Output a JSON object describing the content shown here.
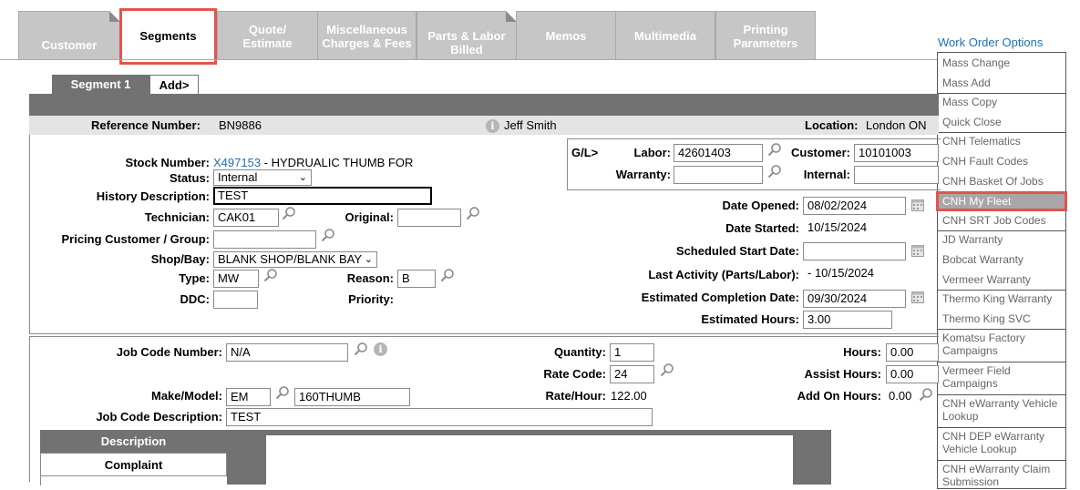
{
  "tabs": [
    {
      "label": "Customer"
    },
    {
      "label": "Segments"
    },
    {
      "label": "Quote/ Estimate"
    },
    {
      "label": "Miscellaneous Charges & Fees"
    },
    {
      "label": "Parts & Labor Billed"
    },
    {
      "label": "Memos"
    },
    {
      "label": "Multimedia"
    },
    {
      "label": "Printing Parameters"
    }
  ],
  "work_order_options": {
    "label": "Work Order Options",
    "items": [
      "Mass Change",
      "Mass Add",
      "Mass Copy",
      "Quick Close",
      "CNH Telematics",
      "CNH Fault Codes",
      "CNH Basket Of Jobs",
      "CNH My Fleet",
      "CNH SRT Job Codes",
      "JD Warranty",
      "Bobcat Warranty",
      "Vermeer Warranty",
      "Thermo King Warranty",
      "Thermo King SVC",
      "Komatsu Factory Campaigns",
      "Vermeer Field Campaigns",
      "CNH eWarranty Vehicle Lookup",
      "CNH DEP eWarranty Vehicle Lookup",
      "CNH eWarranty Claim Submission"
    ]
  },
  "segment_tabs": {
    "segment1": "Segment 1",
    "add": "Add>"
  },
  "ref_bar": {
    "reference_label": "Reference Number:",
    "reference_value": "BN9886",
    "user": "Jeff Smith",
    "location_label": "Location:",
    "location_value": "London ON"
  },
  "segment": {
    "stock_label": "Stock Number:",
    "stock_link": "X497153",
    "stock_desc": " - HYDRUALIC THUMB FOR",
    "status_label": "Status:",
    "status_value": "Internal",
    "history_label": "History Description:",
    "history_value": "TEST",
    "technician_label": "Technician:",
    "technician_value": "CAK01",
    "original_label": "Original:",
    "original_value": "",
    "pricing_label": "Pricing Customer / Group:",
    "pricing_value": "",
    "shopbay_label": "Shop/Bay:",
    "shopbay_value": "BLANK SHOP/BLANK BAY",
    "type_label": "Type:",
    "type_value": "MW",
    "reason_label": "Reason:",
    "reason_value": "B",
    "ddc_label": "DDC:",
    "ddc_value": "",
    "priority_label": "Priority:",
    "gl_label": "G/L>",
    "labor_label": "Labor:",
    "labor_value": "42601403",
    "customer_label": "Customer:",
    "customer_value": "10101003",
    "warranty_label": "Warranty:",
    "warranty_value": "",
    "internal_label": "Internal:",
    "internal_value": "",
    "date_opened_label": "Date Opened:",
    "date_opened_value": "08/02/2024",
    "date_started_label": "Date Started:",
    "date_started_value": "10/15/2024",
    "sched_start_label": "Scheduled Start Date:",
    "sched_start_value": "",
    "last_activity_label": "Last Activity (Parts/Labor):",
    "last_activity_value": "-  10/15/2024",
    "est_completion_label": "Estimated Completion Date:",
    "est_completion_value": "09/30/2024",
    "est_hours_label": "Estimated Hours:",
    "est_hours_value": "3.00"
  },
  "job": {
    "job_code_label": "Job Code Number:",
    "job_code_value": "N/A",
    "quantity_label": "Quantity:",
    "quantity_value": "1",
    "rate_code_label": "Rate Code:",
    "rate_code_value": "24",
    "rate_hour_label": "Rate/Hour:",
    "rate_hour_value": "122.00",
    "hours_label": "Hours:",
    "hours_value": "0.00",
    "assist_label": "Assist Hours:",
    "assist_value": "0.00",
    "addon_label": "Add On Hours:",
    "addon_value": "0.00",
    "make_model_label": "Make/Model:",
    "make_value": "EM",
    "model_value": "160THUMB",
    "job_desc_label": "Job Code Description:",
    "job_desc_value": "TEST",
    "description_header": "Description",
    "complaint_label": "Complaint"
  },
  "colors": {
    "accent_red": "#e0554d",
    "link_blue": "#1f6fb2",
    "tab_gray": "#c6c6c6",
    "bar_gray": "#727272"
  }
}
